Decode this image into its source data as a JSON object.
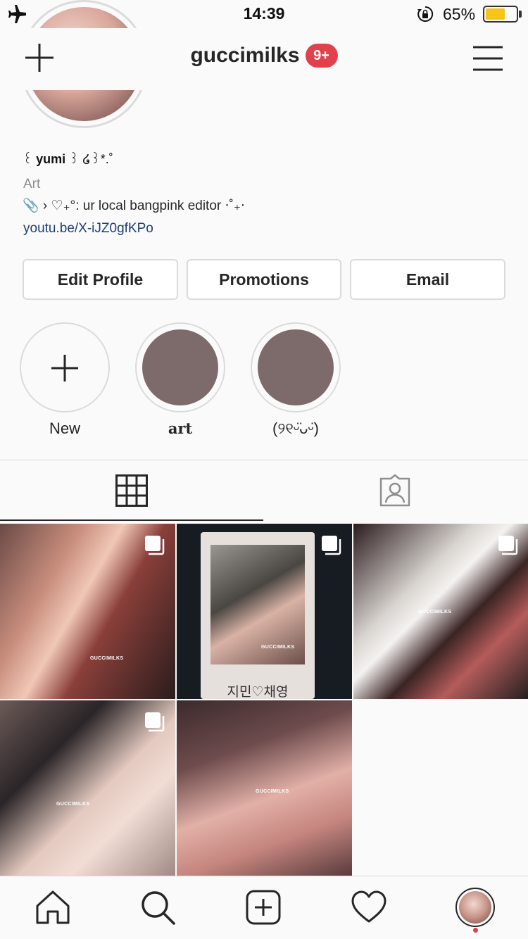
{
  "status_bar": {
    "time": "14:39",
    "battery_percent": "65%",
    "battery_level": 0.65,
    "icons": [
      "airplane-icon",
      "orientation-lock-icon",
      "battery-icon"
    ]
  },
  "header": {
    "username": "guccimilks",
    "notification_badge": "9+"
  },
  "bio": {
    "name_prefix": "꒰ ",
    "name": "yumi",
    "name_suffix": " ꒱ ໒꒱*.˚",
    "category": "Art",
    "line": "📎 › ♡₊°: ur local bangpink editor ⋅˚₊‧",
    "link": "youtu.be/X-iJZ0gfKPo"
  },
  "actions": {
    "edit_profile": "Edit Profile",
    "promotions": "Promotions",
    "email": "Email"
  },
  "highlights": [
    {
      "label": "New"
    },
    {
      "label": "𝐚𝐫𝐭"
    },
    {
      "label": "(୨୧ᵕ̈ᴗᵕ̈)"
    }
  ],
  "tabs": [
    "grid-tab",
    "tagged-tab"
  ],
  "posts": [
    {
      "watermark": "GUCCIMILKS",
      "multiple": true
    },
    {
      "watermark": "GUCCIMILKS",
      "multiple": true,
      "caption": "지민♡채영"
    },
    {
      "watermark": "GUCCIMILKS",
      "multiple": true
    },
    {
      "watermark": "GUCCIMILKS",
      "multiple": true
    },
    {
      "watermark": "GUCCIMILKS",
      "multiple": false
    }
  ],
  "bottom_nav": [
    "home-icon",
    "search-icon",
    "new-post-icon",
    "activity-heart-icon",
    "profile-avatar"
  ],
  "colors": {
    "badge": "#e0414b",
    "link": "#1d3f70",
    "battery": "#f5c518",
    "highlight_cover": "#7d6b6b"
  }
}
